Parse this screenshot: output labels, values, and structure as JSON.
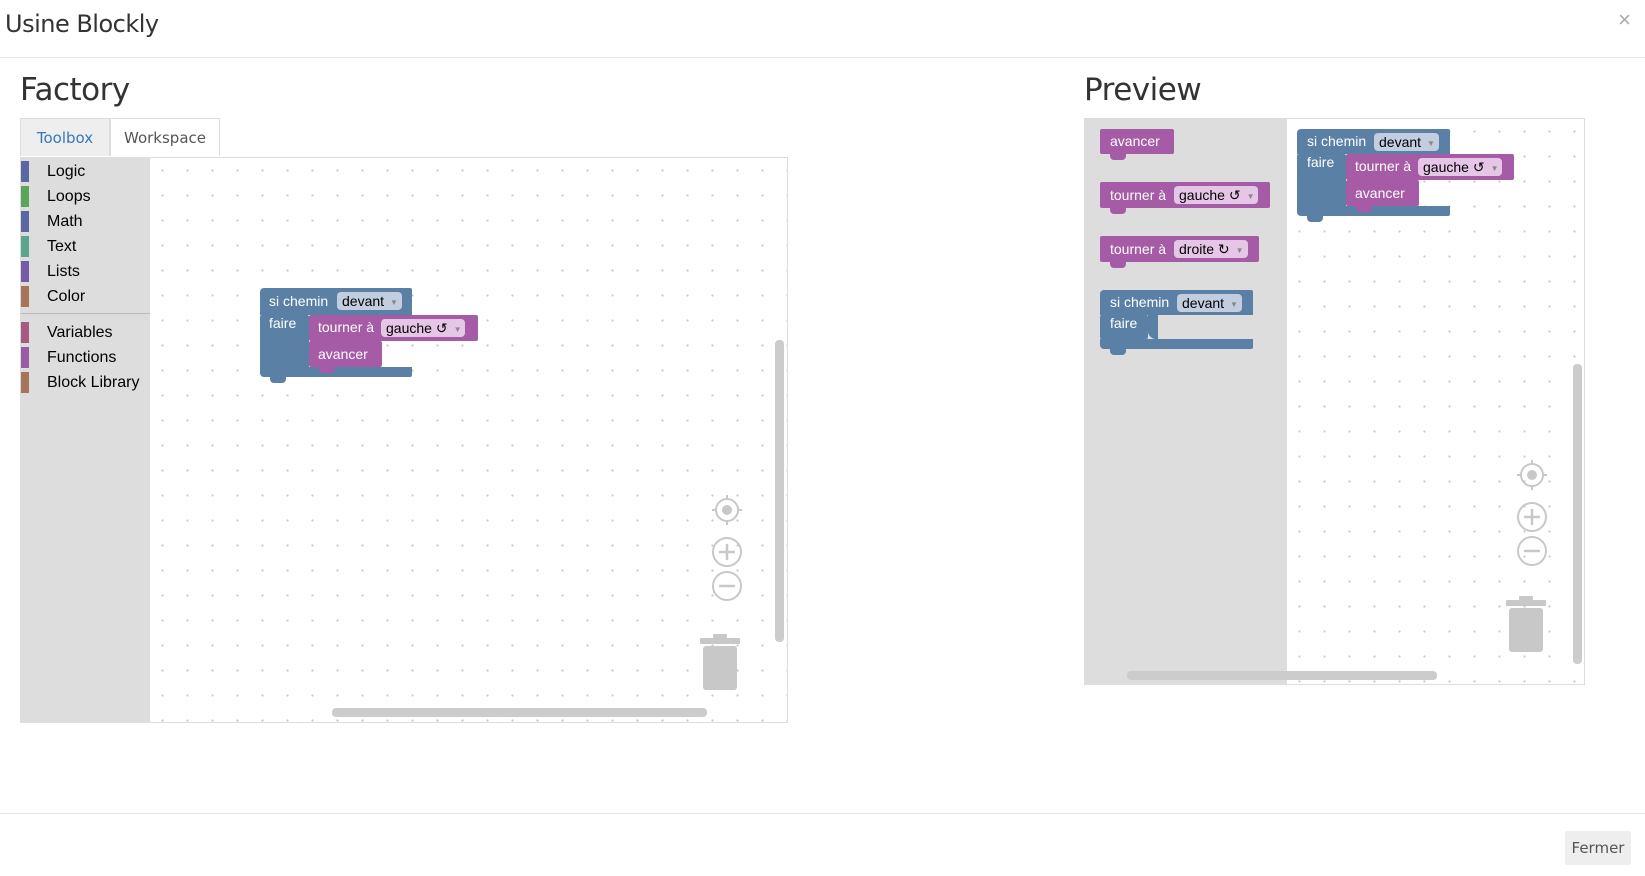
{
  "window": {
    "title": "Usine Blockly",
    "close_glyph": "×"
  },
  "factory": {
    "title": "Factory",
    "tabs": [
      {
        "label": "Toolbox",
        "active": true
      },
      {
        "label": "Workspace",
        "active": false
      }
    ],
    "categories": [
      {
        "label": "Logic",
        "color": "#5b67a5"
      },
      {
        "label": "Loops",
        "color": "#5ba55b"
      },
      {
        "label": "Math",
        "color": "#5b67a5"
      },
      {
        "label": "Text",
        "color": "#5ba58c"
      },
      {
        "label": "Lists",
        "color": "#745ba5"
      },
      {
        "label": "Color",
        "color": "#a5745b"
      },
      {
        "label": "Variables",
        "color": "#a55b80"
      },
      {
        "label": "Functions",
        "color": "#995ba5"
      },
      {
        "label": "Block Library",
        "color": "#a5745b"
      }
    ],
    "blocks": {
      "if_path_label": "si chemin",
      "if_path_value": "devant",
      "do_label": "faire",
      "turn_label": "tourner à",
      "turn_value": "gauche ↺",
      "forward_label": "avancer"
    }
  },
  "preview": {
    "title": "Preview",
    "flyout": {
      "forward_label": "avancer",
      "turn_left_label": "tourner à",
      "turn_left_value": "gauche ↺",
      "turn_right_label": "tourner à",
      "turn_right_value": "droite ↻",
      "if_path_label": "si chemin",
      "if_path_value": "devant",
      "do_label": "faire"
    },
    "blocks": {
      "if_path_label": "si chemin",
      "if_path_value": "devant",
      "do_label": "faire",
      "turn_label": "tourner à",
      "turn_value": "gauche ↺",
      "forward_label": "avancer"
    }
  },
  "colors": {
    "logic_block": "#5b80a5",
    "action_block": "#a55ba5"
  },
  "footer": {
    "close_button": "Fermer"
  }
}
